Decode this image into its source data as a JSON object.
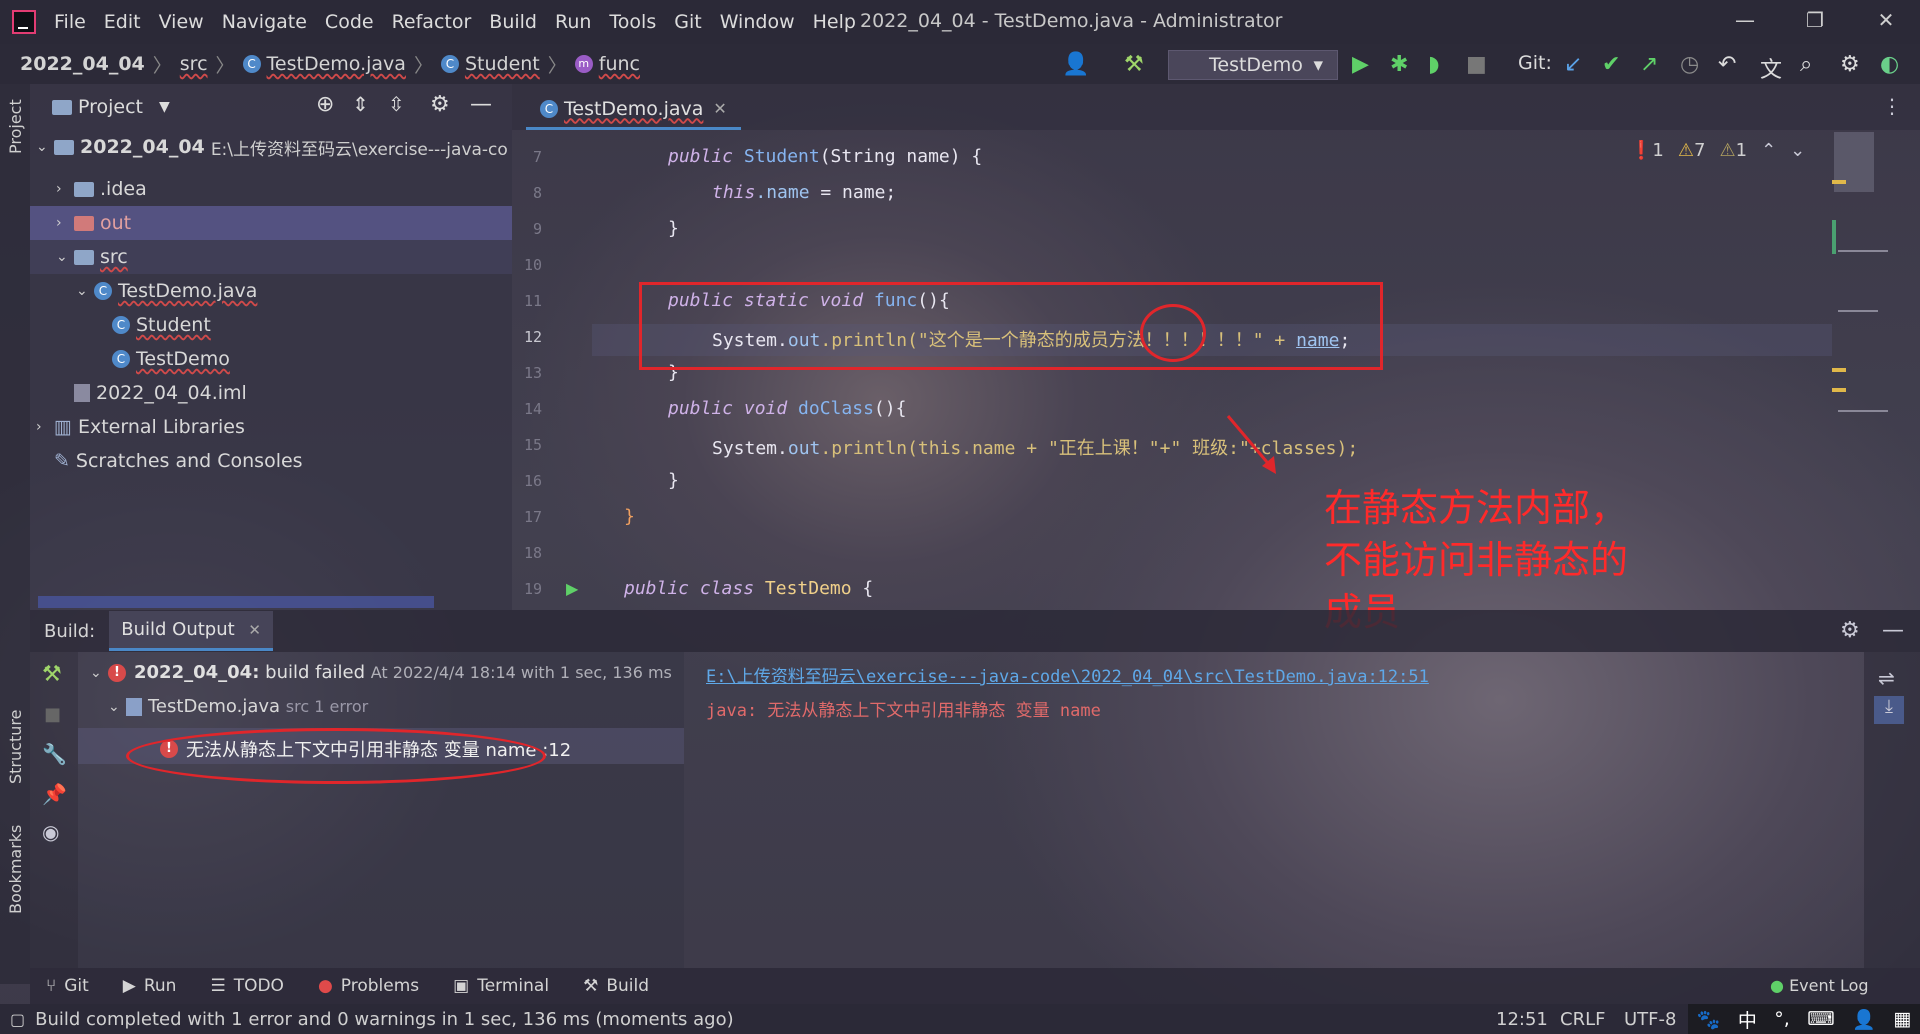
{
  "titlebar": {
    "menus": [
      "File",
      "Edit",
      "View",
      "Navigate",
      "Code",
      "Refactor",
      "Build",
      "Run",
      "Tools",
      "Git",
      "Window",
      "Help"
    ],
    "window_title": "2022_04_04 - TestDemo.java - Administrator"
  },
  "navbar": {
    "crumbs": [
      "2022_04_04",
      "src",
      "TestDemo.java",
      "Student",
      "func"
    ],
    "run_config": "TestDemo",
    "git_label": "Git:"
  },
  "left_strip": {
    "project": "Project",
    "structure": "Structure",
    "bookmarks": "Bookmarks"
  },
  "project": {
    "title": "Project",
    "tree": [
      {
        "label": "2022_04_04",
        "path": "E:\\上传资料至码云\\exercise---java-co"
      },
      {
        "label": ".idea"
      },
      {
        "label": "out"
      },
      {
        "label": "src"
      },
      {
        "label": "TestDemo.java"
      },
      {
        "label": "Student"
      },
      {
        "label": "TestDemo"
      },
      {
        "label": "2022_04_04.iml"
      },
      {
        "label": "External Libraries"
      },
      {
        "label": "Scratches and Consoles"
      }
    ]
  },
  "editor": {
    "tab": "TestDemo.java",
    "inspections": {
      "errors": "1",
      "warnings": "7",
      "weak": "1"
    },
    "line_numbers": [
      "7",
      "8",
      "9",
      "10",
      "11",
      "12",
      "13",
      "14",
      "15",
      "16",
      "17",
      "18",
      "19"
    ],
    "lines": [
      {
        "a": "public ",
        "b": "Student",
        "c": "(String name) {"
      },
      {
        "a": "this",
        "b": ".name",
        "c": " = name;"
      },
      {
        "a": "}",
        "b": "",
        "c": ""
      },
      {
        "a": "",
        "b": "",
        "c": ""
      },
      {
        "a": "public static void ",
        "b": "func",
        "c": "(){"
      },
      {
        "a": "System.",
        "b": "out",
        "c": ".println(\"这个是一个静态的成员方法！！！！！！\" + ",
        "d": "name",
        ";": ";"
      },
      {
        "a": "}",
        "b": "",
        "c": ""
      },
      {
        "a": "public void ",
        "b": "doClass",
        "c": "(){"
      },
      {
        "a": "System.",
        "b": "out",
        "c": ".println(this.name + \"正在上课！\"+\" 班级:\"+classes);"
      },
      {
        "a": "}",
        "b": "",
        "c": ""
      },
      {
        "a": "}",
        "b": "",
        "c": ""
      },
      {
        "a": "",
        "b": "",
        "c": ""
      },
      {
        "a": "public class ",
        "b": "TestDemo",
        "c": " {"
      }
    ]
  },
  "annotation": {
    "line1": "在静态方法内部，",
    "line2": "不能访问非静态的",
    "line3": "成员"
  },
  "build": {
    "label": "Build:",
    "tab": "Build Output",
    "root": "2022_04_04:",
    "root_status": "build failed",
    "root_time": "At 2022/4/4 18:14 with 1 sec, 136 ms",
    "file": "TestDemo.java",
    "file_meta": "src 1 error",
    "error": "无法从静态上下文中引用非静态 变量 name :12",
    "output_link": "E:\\上传资料至码云\\exercise---java-code\\2022_04_04\\src\\TestDemo.java:12:51",
    "output_msg": "java: 无法从静态上下文中引用非静态 变量 name"
  },
  "tool_tabs": [
    "Git",
    "Run",
    "TODO",
    "Problems",
    "Terminal",
    "Build"
  ],
  "event_log": "Event Log",
  "status": {
    "message": "Build completed with 1 error and 0 warnings in 1 sec, 136 ms (moments ago)",
    "position": "12:51",
    "line_sep": "CRLF",
    "encoding": "UTF-8"
  },
  "tray": {
    "ime": "中"
  },
  "colors": {
    "accent": "#4a88c7",
    "error": "#d84a4a",
    "annotation": "#e0262b"
  }
}
